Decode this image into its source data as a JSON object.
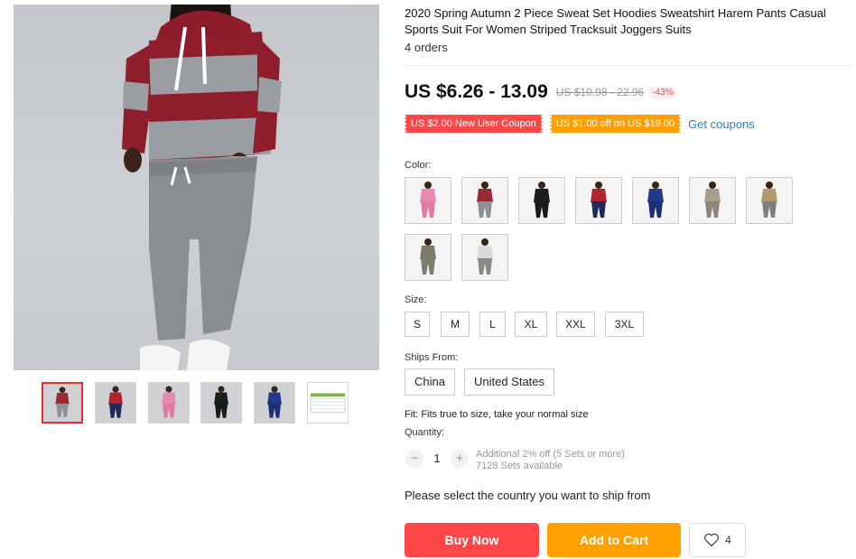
{
  "product": {
    "title": "2020 Spring Autumn 2 Piece Sweat Set Hoodies Sweatshirt Harem Pants Casual Sports Suit For Women Striped Tracksuit Joggers Suits",
    "orders": "4 orders"
  },
  "price": {
    "current": "US $6.26 - 13.09",
    "original": "US $10.98 - 22.96",
    "discount": "-43%"
  },
  "coupons": {
    "new_user": "US $2.00 New User Coupon",
    "store": "US $1.00 off on US $19.00",
    "get_link": "Get coupons"
  },
  "color": {
    "label": "Color:",
    "options": [
      {
        "name": "pink",
        "top": "#e58ab0",
        "pants": "#e27aa6"
      },
      {
        "name": "red-gray",
        "top": "#9b2636",
        "pants": "#8e9196"
      },
      {
        "name": "black",
        "top": "#1c1c1c",
        "pants": "#1a1a1a"
      },
      {
        "name": "red-navy",
        "top": "#b3232f",
        "pants": "#1d2a5a"
      },
      {
        "name": "navy",
        "top": "#233a8a",
        "pants": "#1f2f73"
      },
      {
        "name": "khaki",
        "top": "#a99e8d",
        "pants": "#8d8679"
      },
      {
        "name": "khaki-gray",
        "top": "#b59a6e",
        "pants": "#7f7f7f"
      },
      {
        "name": "army",
        "top": "#7d7b6a",
        "pants": "#7d7b6a"
      },
      {
        "name": "gray-white",
        "top": "#d9d9d9",
        "pants": "#8a8a82"
      }
    ]
  },
  "size": {
    "label": "Size:",
    "options": [
      "S",
      "M",
      "L",
      "XL",
      "XXL",
      "3XL"
    ]
  },
  "ships_from": {
    "label": "Ships From:",
    "options": [
      "China",
      "United States"
    ]
  },
  "fit_note": "Fit: Fits true to size, take your normal size",
  "quantity": {
    "label": "Quantity:",
    "value": "1",
    "minus": "−",
    "plus": "+",
    "additional": "Additional 2% off (5 Sets or more)",
    "available": "7128 Sets available"
  },
  "ship_note": "Please select the country you want to ship from",
  "actions": {
    "buy_now": "Buy Now",
    "add_to_cart": "Add to Cart",
    "wishlist_count": "4"
  },
  "gallery": {
    "thumbs": [
      {
        "top": "#9b2636",
        "pants": "#8e9196"
      },
      {
        "top": "#b3232f",
        "pants": "#1d2a5a"
      },
      {
        "top": "#e58ab0",
        "pants": "#e27aa6"
      },
      {
        "top": "#1c1c1c",
        "pants": "#1a1a1a"
      },
      {
        "top": "#233a8a",
        "pants": "#1f2f73"
      },
      {
        "top": "#e8e8e8",
        "pants": "#bdbdbd"
      }
    ]
  }
}
